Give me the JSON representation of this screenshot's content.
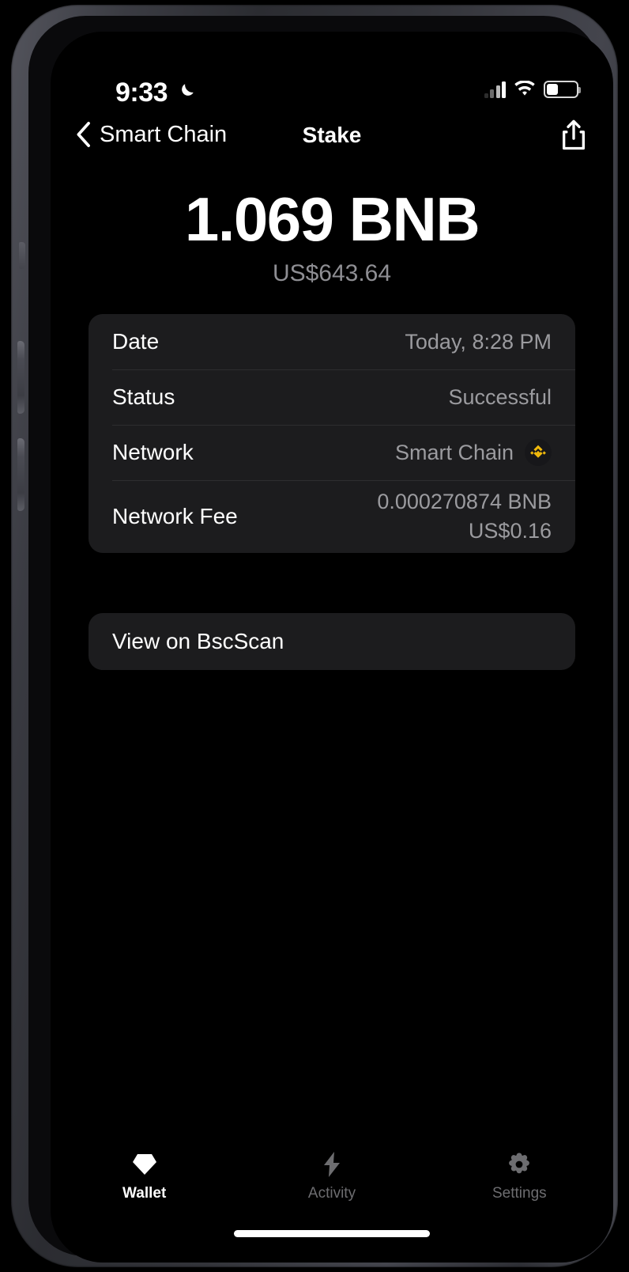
{
  "status_bar": {
    "time": "9:33",
    "dnd_icon": "crescent-moon-icon",
    "cellular_icon": "cellular-signal-icon",
    "wifi_icon": "wifi-icon",
    "battery_icon": "battery-icon",
    "battery_level_percent": 35
  },
  "nav": {
    "back_label": "Smart Chain",
    "back_icon": "chevron-left-icon",
    "title": "Stake",
    "share_icon": "share-icon"
  },
  "hero": {
    "amount": "1.069 BNB",
    "fiat": "US$643.64"
  },
  "details": {
    "rows": [
      {
        "label": "Date",
        "value": "Today, 8:28 PM"
      },
      {
        "label": "Status",
        "value": "Successful"
      },
      {
        "label": "Network",
        "value": "Smart Chain",
        "icon": "bnb-logo-icon"
      },
      {
        "label": "Network Fee",
        "value": "0.000270874 BNB",
        "value_secondary": "US$0.16"
      }
    ]
  },
  "link": {
    "label": "View on BscScan"
  },
  "tabs": [
    {
      "label": "Wallet",
      "icon": "diamond-icon",
      "active": true
    },
    {
      "label": "Activity",
      "icon": "bolt-icon",
      "active": false
    },
    {
      "label": "Settings",
      "icon": "gear-icon",
      "active": false
    }
  ],
  "colors": {
    "background": "#000000",
    "card": "#1c1c1e",
    "accent_bnb": "#f0b90b",
    "text_primary": "#ffffff",
    "text_secondary": "#8e8e93"
  }
}
